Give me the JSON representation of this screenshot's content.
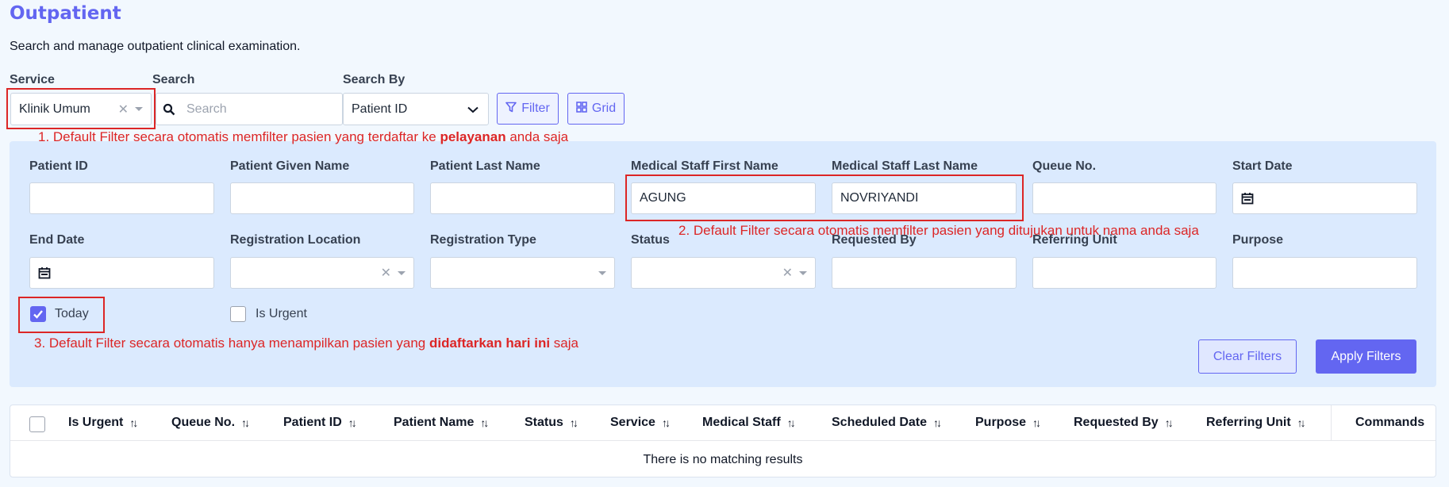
{
  "page": {
    "title": "Outpatient",
    "subtitle": "Search and manage outpatient clinical examination."
  },
  "toolbar": {
    "service_label": "Service",
    "service_value": "Klinik Umum",
    "search_label": "Search",
    "search_placeholder": "Search",
    "search_by_label": "Search By",
    "search_by_value": "Patient ID",
    "filter_button": "Filter",
    "grid_button": "Grid"
  },
  "annotations": {
    "note1_prefix": "1. Default Filter secara otomatis memfilter pasien yang terdaftar ke ",
    "note1_bold": "pelayanan",
    "note1_suffix": " anda saja",
    "note2": "2. Default Filter secara otomatis memfilter pasien yang ditujukan untuk nama anda saja",
    "note3_prefix": "3. Default Filter secara otomatis hanya menampilkan pasien yang ",
    "note3_bold": "didaftarkan hari ini",
    "note3_suffix": " saja"
  },
  "filters": {
    "patient_id": {
      "label": "Patient ID",
      "value": ""
    },
    "given_name": {
      "label": "Patient Given Name",
      "value": ""
    },
    "last_name": {
      "label": "Patient Last Name",
      "value": ""
    },
    "staff_first": {
      "label": "Medical Staff First Name",
      "value": "AGUNG"
    },
    "staff_last": {
      "label": "Medical Staff Last Name",
      "value": "NOVRIYANDI"
    },
    "queue_no": {
      "label": "Queue No.",
      "value": ""
    },
    "start_date": {
      "label": "Start Date",
      "value": ""
    },
    "end_date": {
      "label": "End Date",
      "value": ""
    },
    "reg_location": {
      "label": "Registration Location",
      "value": ""
    },
    "reg_type": {
      "label": "Registration Type",
      "value": ""
    },
    "status": {
      "label": "Status",
      "value": ""
    },
    "requested_by": {
      "label": "Requested By",
      "value": ""
    },
    "referring_unit": {
      "label": "Referring Unit",
      "value": ""
    },
    "purpose": {
      "label": "Purpose",
      "value": ""
    },
    "today": {
      "label": "Today",
      "checked": true
    },
    "is_urgent": {
      "label": "Is Urgent",
      "checked": false
    },
    "clear_button": "Clear Filters",
    "apply_button": "Apply Filters"
  },
  "table": {
    "columns": [
      "Is Urgent",
      "Queue No.",
      "Patient ID",
      "Patient Name",
      "Status",
      "Service",
      "Medical Staff",
      "Scheduled Date",
      "Purpose",
      "Requested By",
      "Referring Unit",
      "Commands"
    ],
    "empty_text": "There is no matching results"
  },
  "colors": {
    "accent": "#6366f1",
    "panel": "#dbeafe",
    "annotation": "#dc2626"
  }
}
